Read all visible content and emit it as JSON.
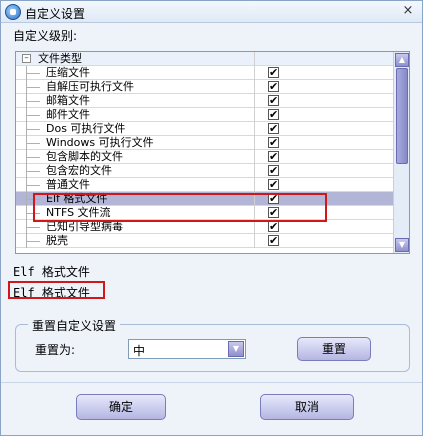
{
  "window": {
    "title": "自定义设置",
    "close_glyph": "×"
  },
  "level_label": "自定义级别:",
  "tree": {
    "rows": [
      {
        "label": "文件类型",
        "group": true,
        "expander": "–",
        "checked": null,
        "selected": false
      },
      {
        "label": "压缩文件",
        "checked": true,
        "selected": false
      },
      {
        "label": "自解压可执行文件",
        "checked": true,
        "selected": false
      },
      {
        "label": "邮箱文件",
        "checked": true,
        "selected": false
      },
      {
        "label": "邮件文件",
        "checked": true,
        "selected": false
      },
      {
        "label": "Dos 可执行文件",
        "checked": true,
        "selected": false
      },
      {
        "label": "Windows 可执行文件",
        "checked": true,
        "selected": false
      },
      {
        "label": "包含脚本的文件",
        "checked": true,
        "selected": false
      },
      {
        "label": "包含宏的文件",
        "checked": true,
        "selected": false
      },
      {
        "label": "普通文件",
        "checked": true,
        "selected": false
      },
      {
        "label": "Elf 格式文件",
        "checked": true,
        "selected": true
      },
      {
        "label": "NTFS 文件流",
        "checked": true,
        "selected": false
      },
      {
        "label": "已知引导型病毒",
        "checked": true,
        "selected": false
      },
      {
        "label": "脱壳",
        "checked": true,
        "selected": false
      }
    ],
    "check_glyph": "✔"
  },
  "description": "Elf 格式文件",
  "description_highlight": "Elf 格式文件",
  "reset": {
    "group_title": "重置自定义设置",
    "label": "重置为:",
    "combo_value": "中",
    "button": "重置"
  },
  "footer": {
    "ok": "确定",
    "cancel": "取消"
  },
  "colors": {
    "selection": "#b3b5d6",
    "highlight_box": "#d01818",
    "accent": "#8f90cc"
  }
}
